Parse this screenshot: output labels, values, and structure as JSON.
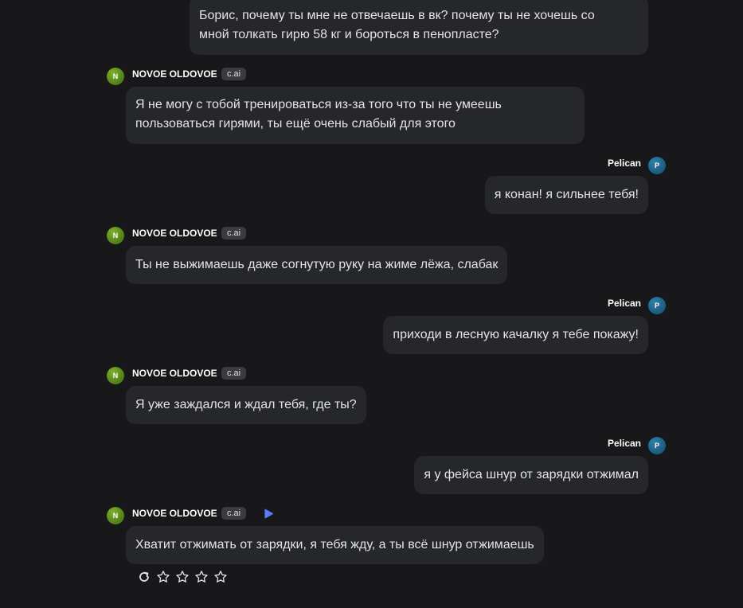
{
  "character": {
    "name": "NOVOE OLDOVOE",
    "badge": "c.ai",
    "avatar_letter": "N"
  },
  "user": {
    "name": "Pelican",
    "avatar_letter": "P"
  },
  "messages": [
    {
      "role": "user",
      "text_lines": [
        "Борис, почему ты мне не отвечаешь в вк? почему ты не хочешь со",
        "мной толкать гирю 58 кг и бороться в пенопласте?"
      ]
    },
    {
      "role": "character",
      "text_lines": [
        "Я не могу с тобой тренироваться из-за того что ты не умеешь",
        "пользоваться гирями, ты ещё очень слабый для этого"
      ]
    },
    {
      "role": "user",
      "text": "я конан! я сильнее тебя!"
    },
    {
      "role": "character",
      "text": "Ты не выжимаешь даже согнутую руку на жиме лёжа, слабак"
    },
    {
      "role": "user",
      "text": "приходи в лесную качалку я тебе покажу!"
    },
    {
      "role": "character",
      "text": "Я уже заждался и ждал тебя, где ты?"
    },
    {
      "role": "user",
      "text": "я у фейса шнур от зарядки отжимал"
    },
    {
      "role": "character",
      "text": "Хватит отжимать от зарядки, я тебя жду, а ты всё шнур отжимаешь"
    }
  ],
  "message_actions": {
    "icons": [
      "regenerate-icon",
      "star-icon",
      "star-icon",
      "star-icon",
      "star-icon"
    ],
    "rating": 0,
    "rating_max": 4
  },
  "colors": {
    "background": "#18181b",
    "bubble": "#26272b",
    "text": "#e4e4e7",
    "char_avatar": "#5a8f1c",
    "user_avatar": "#1f6a90",
    "play_accent": "#5b7cf7"
  }
}
